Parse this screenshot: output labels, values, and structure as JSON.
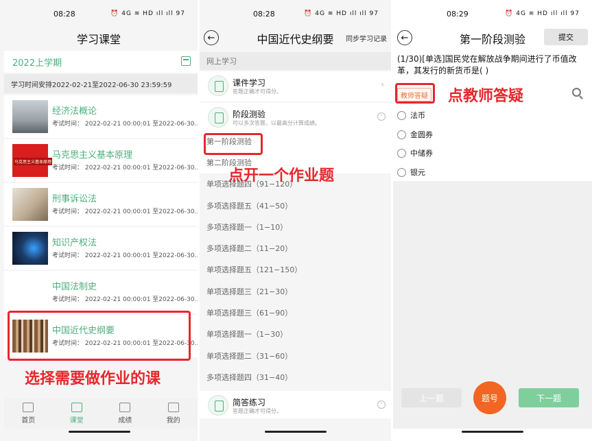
{
  "panel1": {
    "status_time": "08:28",
    "status_icons": "⏰ 4G ≋ HD ıll ıll 97",
    "title": "学习课堂",
    "term": "2022上学期",
    "schedule": "学习时间安排2022-02-21至2022-06-30 23:59:59",
    "courses": [
      {
        "name": "经济法概论",
        "time": "考试时间： 2022-02-21 00:00:01 至2022-06-30..."
      },
      {
        "name": "马克思主义基本原理",
        "time": "考试时间： 2022-02-21 00:00:01 至2022-06-30..."
      },
      {
        "name": "刑事诉讼法",
        "time": "考试时间： 2022-02-21 00:00:01 至2022-06-30..."
      },
      {
        "name": "知识产权法",
        "time": "考试时间： 2022-02-21 00:00:01 至2022-06-30..."
      },
      {
        "name": "中国法制史",
        "time": "考试时间： 2022-02-21 00:00:01 至2022-06-30..."
      },
      {
        "name": "中国近代史纲要",
        "time": "考试时间： 2022-02-21 00:00:01 至2022-06-30..."
      }
    ],
    "thumb2_text": "马克思主义基本原理",
    "annotation": "选择需要做作业的课",
    "tabs": [
      "首页",
      "课堂",
      "成绩",
      "我的"
    ]
  },
  "panel2": {
    "status_time": "08:28",
    "status_icons": "⏰ 4G ≋ HD ıll ıll 97",
    "title": "中国近代史纲要",
    "sync": "同步学习记录",
    "section": "网上学习",
    "modules": [
      {
        "title": "课件学习",
        "sub": "答题正确才可得分。"
      },
      {
        "title": "阶段测验",
        "sub": "可以多次答题，以最高分计算成绩。"
      },
      {
        "title": "简答练习",
        "sub": "答题正确才可得分。"
      }
    ],
    "items": [
      "第一阶段测验",
      "第二阶段测验",
      "单项选择题四（91−120）",
      "多项选择题五（41−50）",
      "多项选择题一（1−10）",
      "多项选择题二（11−20）",
      "单项选择题五（121−150）",
      "单项选择题三（21−30）",
      "单项选择题三（61−90）",
      "单项选择题一（1−30）",
      "单项选择题二（31−60）",
      "多项选择题四（31−40）"
    ],
    "annotation": "点开一个作业题"
  },
  "panel3": {
    "status_time": "08:29",
    "status_icons": "⏰ 4G ≋ HD ıll ıll 97",
    "title": "第一阶段测验",
    "submit": "提交",
    "question": "(1/30)[单选]国民党在解放战争期间进行了币值改革，其发行的新货币是( )",
    "teacher_btn": "教师答疑",
    "annotation": "点教师答疑",
    "options": [
      "法币",
      "金圆券",
      "中储券",
      "银元"
    ],
    "prev": "上一题",
    "num": "题号",
    "next": "下一题"
  }
}
